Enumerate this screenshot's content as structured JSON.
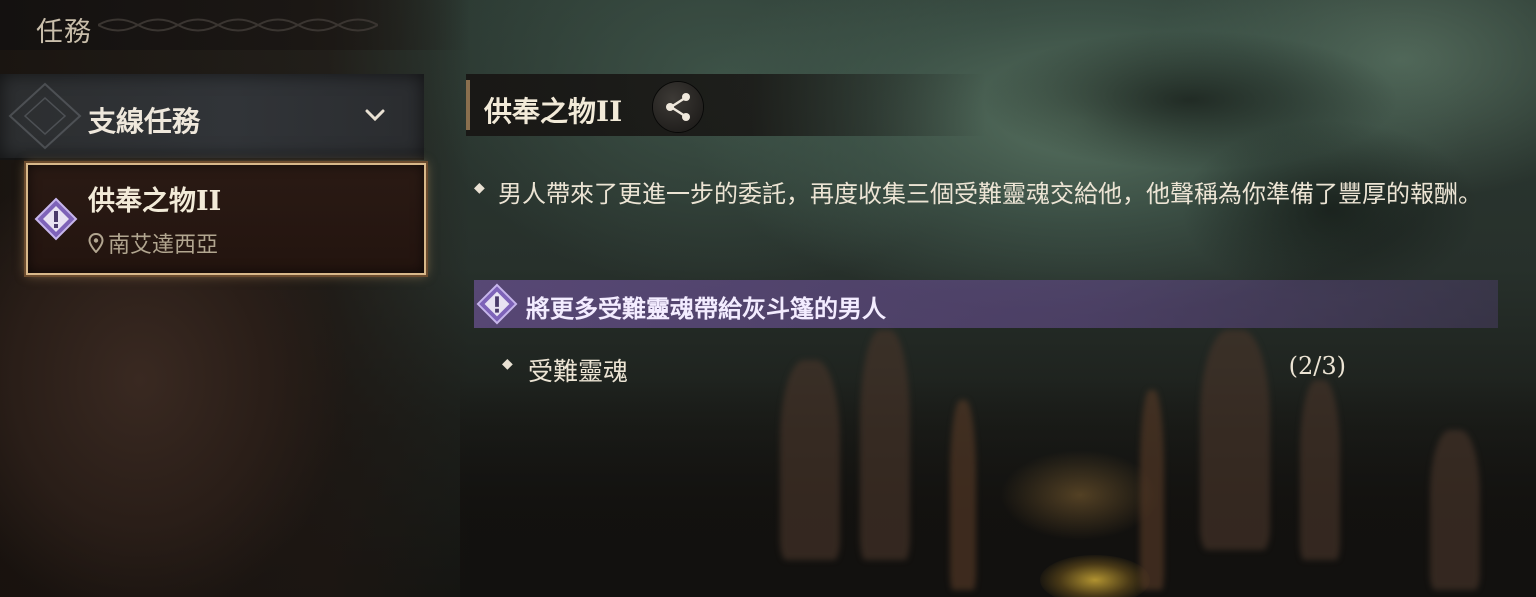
{
  "topbar": {
    "title": "任務"
  },
  "category": {
    "label": "支線任務",
    "chevron_icon": "chevron-down-icon"
  },
  "quest_list": [
    {
      "title": "供奉之物II",
      "location": "南艾達西亞",
      "icon": "exclamation-diamond-icon"
    }
  ],
  "detail": {
    "title": "供奉之物II",
    "share_icon": "share-icon",
    "description": "男人帶來了更進一步的委託，再度收集三個受難靈魂交給他，他聲稱為你準備了豐厚的報酬。",
    "objective": "將更多受難靈魂帶給灰斗篷的男人",
    "tasks": [
      {
        "label": "受難靈魂",
        "progress": "(2/3)"
      }
    ]
  },
  "colors": {
    "objective_bar": "#604c82",
    "card_border": "#d8b88a",
    "accent_purple": "#7e63b8"
  }
}
